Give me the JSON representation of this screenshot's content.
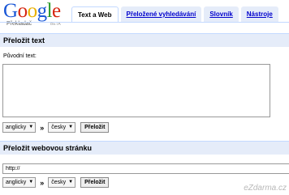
{
  "logo": {
    "letters": [
      {
        "ch": "G",
        "color": "#1a57d6"
      },
      {
        "ch": "o",
        "color": "#d6250f"
      },
      {
        "ch": "o",
        "color": "#e9b100"
      },
      {
        "ch": "g",
        "color": "#1a57d6"
      },
      {
        "ch": "l",
        "color": "#2a9a2a"
      },
      {
        "ch": "e",
        "color": "#d6250f"
      }
    ],
    "subtitle": "Překladač",
    "beta": "BETA"
  },
  "tabs": [
    {
      "label": "Text a Web",
      "active": true
    },
    {
      "label": "Přeložené vyhledávání",
      "active": false
    },
    {
      "label": "Slovník",
      "active": false
    },
    {
      "label": "Nástroje",
      "active": false
    }
  ],
  "text_section": {
    "title": "Přeložit text",
    "source_label": "Původní text:",
    "from_lang": "anglicky",
    "to_lang": "česky",
    "swap": "»",
    "button": "Přeložit"
  },
  "web_section": {
    "title": "Přeložit webovou stránku",
    "url_value": "http://",
    "from_lang": "anglicky",
    "to_lang": "česky",
    "swap": "»",
    "button": "Přeložit"
  },
  "watermark": "eZdarma.cz"
}
